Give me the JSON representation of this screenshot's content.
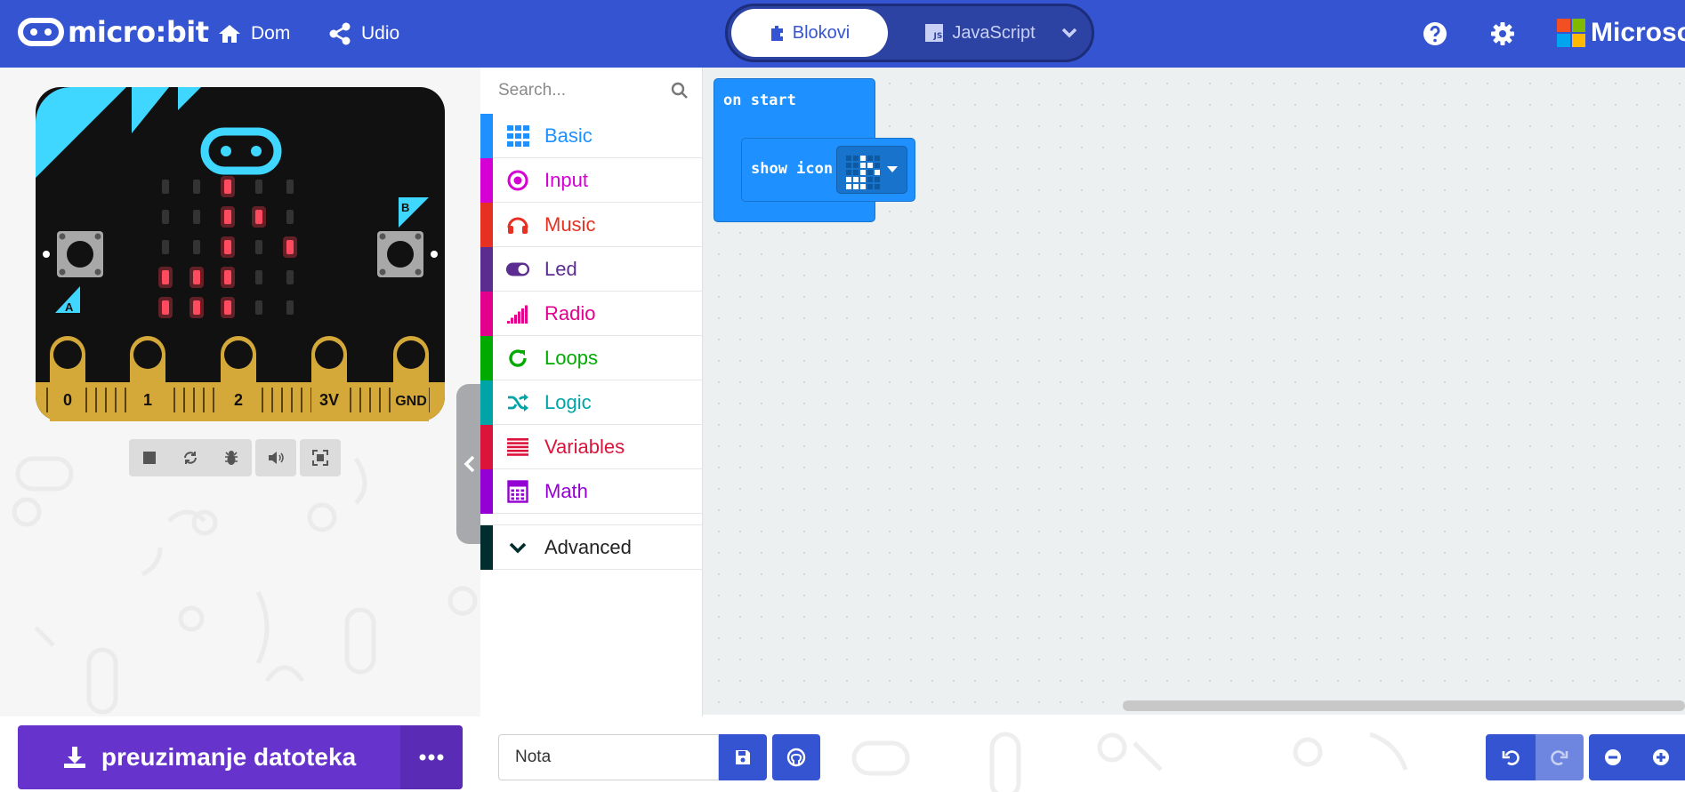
{
  "header": {
    "logo_text": "micro:bit",
    "nav": {
      "home_label": "Dom",
      "share_label": "Udio"
    },
    "mode": {
      "blocks_label": "Blokovi",
      "js_label": "JavaScript",
      "js_badge": "JS"
    },
    "brand_text": "Microsoft",
    "colors": {
      "header_bg": "#3454d1",
      "toggle_bg": "#2d43a4"
    }
  },
  "simulator": {
    "pin_labels": [
      "0",
      "1",
      "2",
      "3V",
      "GND"
    ],
    "button_a": "A",
    "button_b": "B",
    "led_rows": [
      [
        0,
        0,
        1,
        0,
        0
      ],
      [
        0,
        0,
        1,
        1,
        0
      ],
      [
        0,
        0,
        1,
        0,
        1
      ],
      [
        1,
        1,
        1,
        0,
        0
      ],
      [
        1,
        1,
        1,
        0,
        0
      ]
    ],
    "controls": [
      "stop-icon",
      "restart-icon",
      "debug-icon",
      "mute-icon",
      "fullscreen-icon"
    ]
  },
  "toolbox": {
    "search_placeholder": "Search...",
    "categories": [
      {
        "label": "Basic",
        "color": "#1e90ff",
        "icon": "grid-icon"
      },
      {
        "label": "Input",
        "color": "#d400d4",
        "icon": "target-icon"
      },
      {
        "label": "Music",
        "color": "#e63022",
        "icon": "headphones-icon"
      },
      {
        "label": "Led",
        "color": "#5c2d91",
        "icon": "toggle-icon"
      },
      {
        "label": "Radio",
        "color": "#e3008c",
        "icon": "signal-icon"
      },
      {
        "label": "Loops",
        "color": "#00aa00",
        "icon": "refresh-icon"
      },
      {
        "label": "Logic",
        "color": "#00a4a6",
        "icon": "shuffle-icon"
      },
      {
        "label": "Variables",
        "color": "#dc143c",
        "icon": "list-icon"
      },
      {
        "label": "Math",
        "color": "#9400d3",
        "icon": "calculator-icon"
      }
    ],
    "advanced": {
      "label": "Advanced",
      "color": "#002d2d"
    }
  },
  "workspace": {
    "on_start_label": "on start",
    "show_icon_label": "show icon",
    "block_color": "#1e90ff"
  },
  "bottom": {
    "download_label": "preuzimanje datoteka",
    "project_name": "Nota",
    "download_color": "#6633cc"
  }
}
